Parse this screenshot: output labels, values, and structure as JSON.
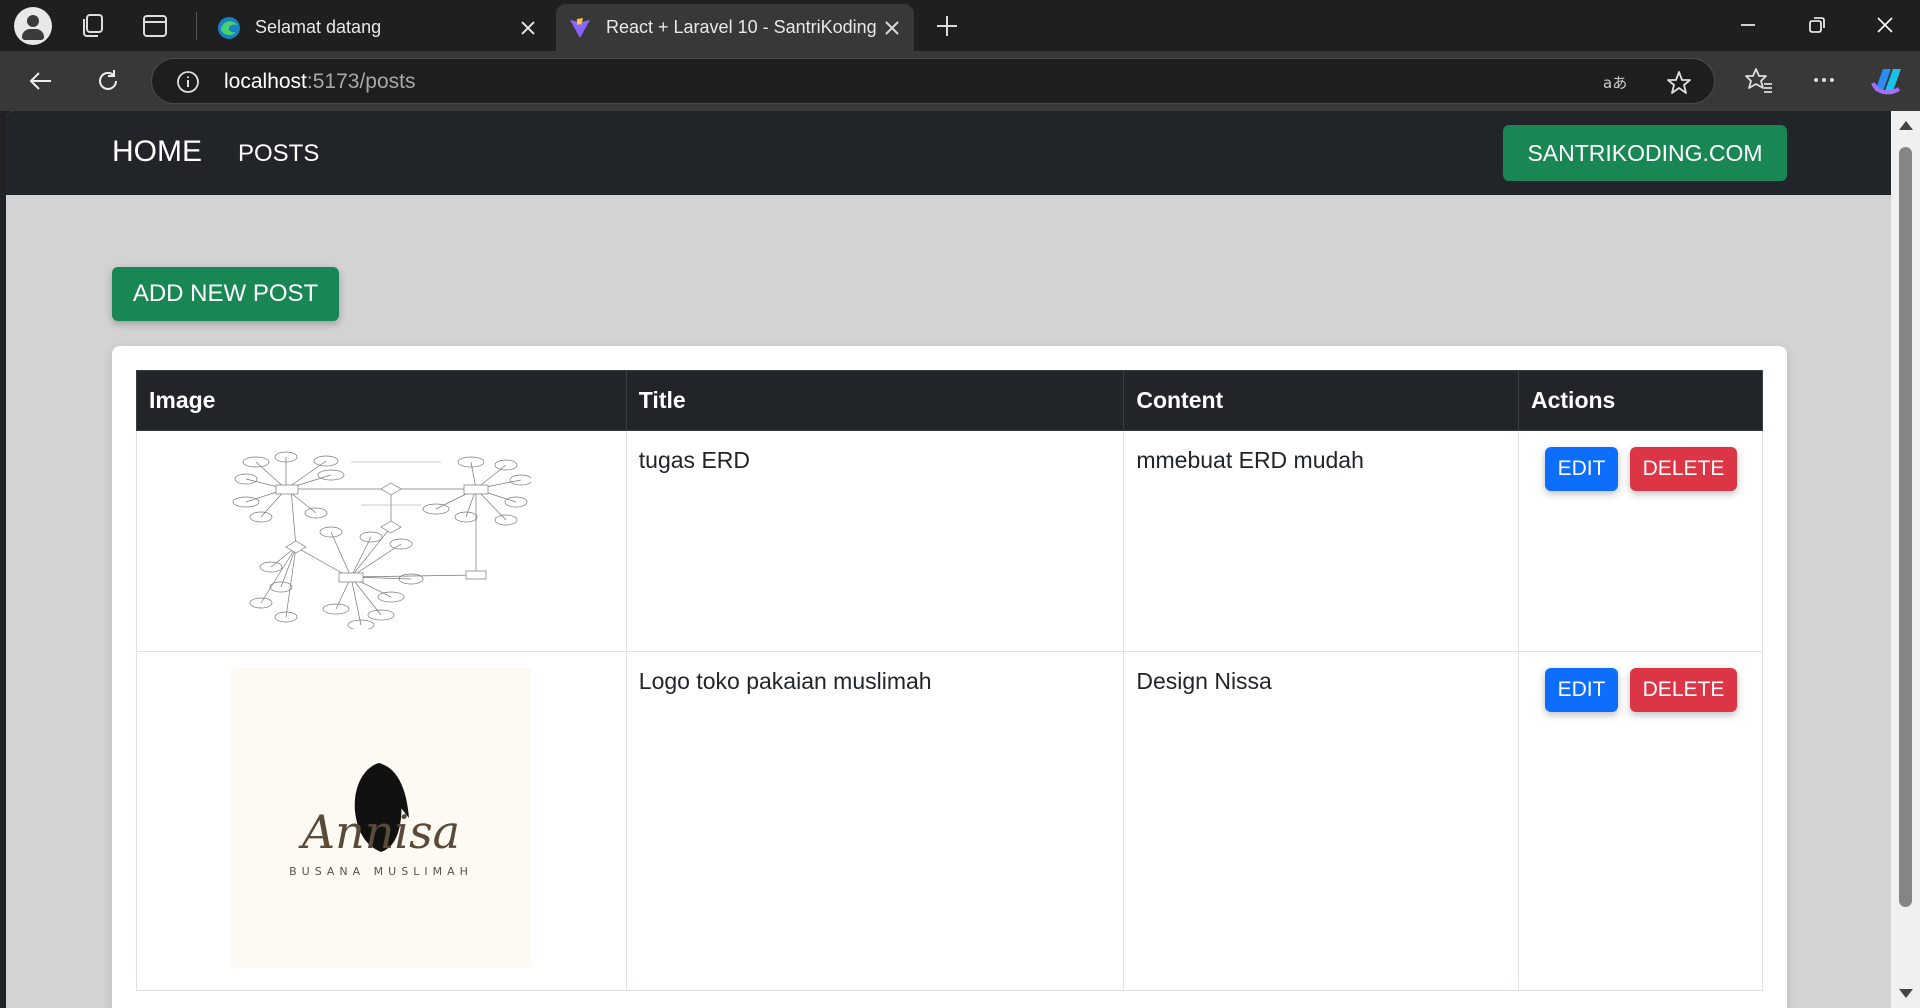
{
  "browser": {
    "tabs": [
      {
        "title": "Selamat datang"
      },
      {
        "title": "React + Laravel 10 - SantriKoding"
      }
    ],
    "address": {
      "host": "localhost",
      "rest": ":5173/posts"
    }
  },
  "navbar": {
    "brand": "HOME",
    "posts_link": "POSTS",
    "external_button": "SANTRIKODING.COM"
  },
  "page": {
    "add_button": "ADD NEW POST"
  },
  "table": {
    "headers": {
      "image": "Image",
      "title": "Title",
      "content": "Content",
      "actions": "Actions"
    },
    "rows": [
      {
        "title": "tugas ERD",
        "content": "mmebuat ERD mudah",
        "edit": "EDIT",
        "delete": "DELETE"
      },
      {
        "title": "Logo toko pakaian muslimah",
        "content": "Design Nissa",
        "edit": "EDIT",
        "delete": "DELETE",
        "logo_script": "Annisa",
        "logo_tagline": "BUSANA MUSLIMAH"
      }
    ]
  },
  "colors": {
    "navbar": "#212529",
    "success": "#198754",
    "primary": "#0d6efd",
    "danger": "#dc3545",
    "page_bg": "#d3d3d3"
  }
}
